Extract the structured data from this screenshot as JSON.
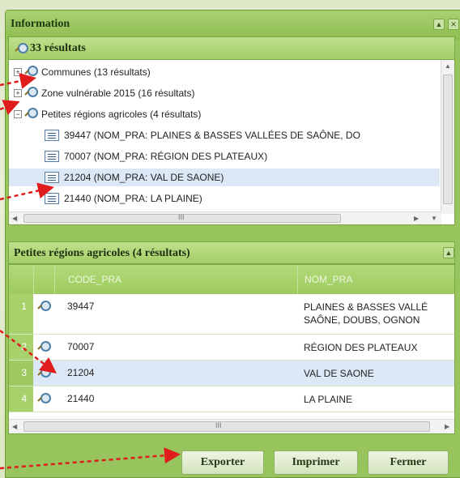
{
  "window": {
    "title": "Information"
  },
  "results": {
    "header": "33 résultats",
    "tree": [
      {
        "label": "Communes (13 résultats)",
        "expander": "+"
      },
      {
        "label": "Zone vulnérable 2015 (16 résultats)",
        "expander": "+"
      },
      {
        "label": "Petites régions agricoles (4 résultats)",
        "expander": "−"
      },
      {
        "label": "39447 (NOM_PRA: PLAINES & BASSES VALLÉES DE SAÔNE, DO"
      },
      {
        "label": "70007 (NOM_PRA: RÉGION DES PLATEAUX)"
      },
      {
        "label": "21204 (NOM_PRA: VAL DE SAONE)"
      },
      {
        "label": "21440 (NOM_PRA: LA PLAINE)"
      }
    ],
    "hscroll_mark": "III"
  },
  "grid": {
    "title": "Petites régions agricoles (4 résultats)",
    "columns": [
      "CODE_PRA",
      "NOM_PRA"
    ],
    "rows": [
      {
        "num": "1",
        "code": "39447",
        "nom": "PLAINES & BASSES VALLÉ",
        "nom2": "SAÔNE, DOUBS, OGNON"
      },
      {
        "num": "2",
        "code": "70007",
        "nom": "RÉGION DES PLATEAUX"
      },
      {
        "num": "3",
        "code": "21204",
        "nom": "VAL DE SAONE"
      },
      {
        "num": "4",
        "code": "21440",
        "nom": "LA PLAINE"
      }
    ],
    "hscroll_mark": "III"
  },
  "buttons": {
    "export": "Exporter",
    "print": "Imprimer",
    "close": "Fermer"
  },
  "colors": {
    "panel": "#97c45c",
    "selection": "#dde8f6",
    "annotation": "#e01c1c"
  }
}
